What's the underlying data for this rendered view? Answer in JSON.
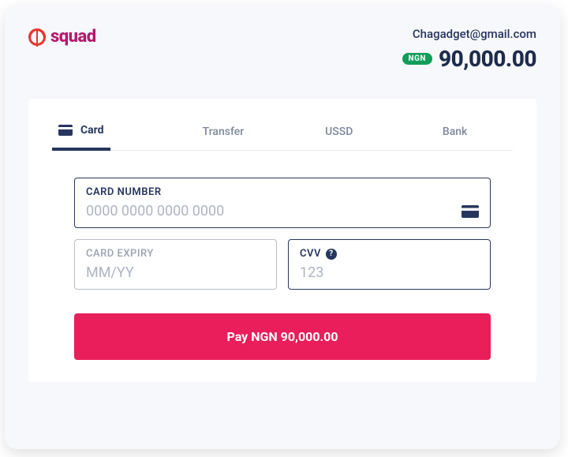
{
  "brand": {
    "name": "squad"
  },
  "account": {
    "email": "Chagadget@gmail.com",
    "currency_badge": "NGN",
    "amount": "90,000.00"
  },
  "tabs": {
    "card": "Card",
    "transfer": "Transfer",
    "ussd": "USSD",
    "bank": "Bank"
  },
  "form": {
    "card_number": {
      "label": "CARD NUMBER",
      "placeholder": "0000 0000 0000 0000"
    },
    "expiry": {
      "label": "CARD EXPIRY",
      "placeholder": "MM/YY"
    },
    "cvv": {
      "label": "CVV",
      "placeholder": "123",
      "help": "?"
    }
  },
  "pay_button": "Pay NGN 90,000.00"
}
